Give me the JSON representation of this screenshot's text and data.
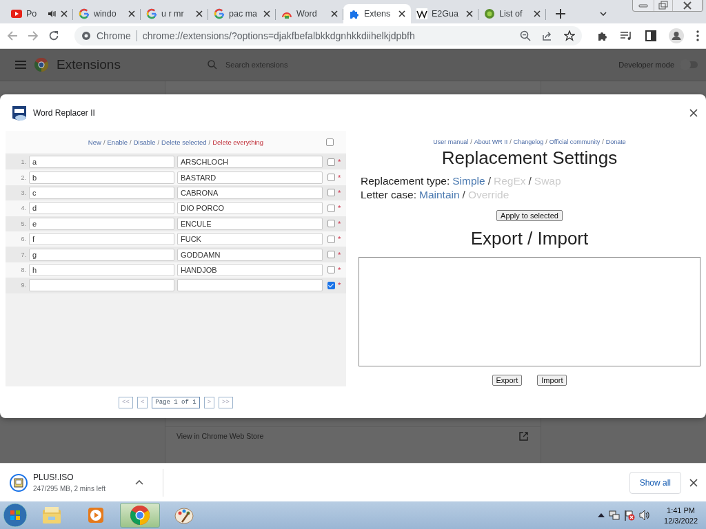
{
  "browser": {
    "tabs": [
      {
        "title": "Po",
        "kind": "youtube",
        "audio": true,
        "selected": false
      },
      {
        "title": "windo",
        "kind": "google",
        "audio": false,
        "selected": false
      },
      {
        "title": "u r mr",
        "kind": "google",
        "audio": false,
        "selected": false
      },
      {
        "title": "pac ma",
        "kind": "google",
        "audio": false,
        "selected": false
      },
      {
        "title": "Word",
        "kind": "rainbow",
        "audio": false,
        "selected": false
      },
      {
        "title": "Extens",
        "kind": "puzzle",
        "audio": false,
        "selected": true
      },
      {
        "title": "E2Gua",
        "kind": "wiki",
        "audio": false,
        "selected": false
      },
      {
        "title": "List of",
        "kind": "leaf",
        "audio": false,
        "selected": false
      }
    ],
    "omnibox": {
      "site": "Chrome",
      "url": "chrome://extensions/?options=djakfbefalbkkdgnhkkdiihelkjdpbfh"
    }
  },
  "extensions_page": {
    "title": "Extensions",
    "search": {
      "placeholder": "Search extensions"
    },
    "developer_mode": {
      "label": "Developer mode",
      "on": false
    },
    "card_link": "View in Chrome Web Store"
  },
  "dialog": {
    "title": "Word Replacer II",
    "separator": "/",
    "toolbar_links": [
      {
        "label": "New",
        "kind": "normal"
      },
      {
        "label": "Enable",
        "kind": "normal"
      },
      {
        "label": "Disable",
        "kind": "normal"
      },
      {
        "label": "Delete selected",
        "kind": "normal"
      },
      {
        "label": "Delete everything",
        "kind": "danger"
      }
    ],
    "select_all": false,
    "rows": [
      {
        "number": "1.",
        "find": "a",
        "replace": "ARSCHLOCH",
        "checked": false,
        "marker": "*"
      },
      {
        "number": "2.",
        "find": "b",
        "replace": "BASTARD",
        "checked": false,
        "marker": "*"
      },
      {
        "number": "3.",
        "find": "c",
        "replace": "CABRONA",
        "checked": false,
        "marker": "*"
      },
      {
        "number": "4.",
        "find": "d",
        "replace": "DIO PORCO",
        "checked": false,
        "marker": "*"
      },
      {
        "number": "5.",
        "find": "e",
        "replace": "ENCULE",
        "checked": false,
        "marker": "*"
      },
      {
        "number": "6.",
        "find": "f",
        "replace": "FUCK",
        "checked": false,
        "marker": "*"
      },
      {
        "number": "7.",
        "find": "g",
        "replace": "GODDAMN",
        "checked": false,
        "marker": "*"
      },
      {
        "number": "8.",
        "find": "h",
        "replace": "HANDJOB",
        "checked": false,
        "marker": "*"
      },
      {
        "number": "9.",
        "checked": true,
        "marker": "*"
      }
    ],
    "pager": [
      {
        "label": "<<",
        "disabled": true
      },
      {
        "label": "<",
        "disabled": true
      },
      {
        "label": "Page 1 of 1",
        "disabled": false
      },
      {
        "label": ">",
        "disabled": true
      },
      {
        "label": ">>",
        "disabled": true
      }
    ],
    "help_links": [
      "User manual",
      "About WR II",
      "Changelog",
      "Official community",
      "Donate"
    ],
    "settings": {
      "heading": "Replacement Settings",
      "options": [
        {
          "label": "Replacement type:",
          "choices": [
            {
              "label": "Simple",
              "selected": true
            },
            {
              "label": "RegEx",
              "selected": false
            },
            {
              "label": "Swap",
              "selected": false
            }
          ]
        },
        {
          "label": "Letter case:",
          "choices": [
            {
              "label": "Maintain",
              "selected": true
            },
            {
              "label": "Override",
              "selected": false
            }
          ]
        }
      ],
      "apply_button": "Apply to selected"
    },
    "export_import": {
      "heading": "Export / Import",
      "buttons": [
        "Export",
        "Import"
      ]
    }
  },
  "downloads": {
    "file": "PLUS!.ISO",
    "status": "247/295 MB, 2 mins left",
    "show_all": "Show all"
  },
  "taskbar": {
    "apps": [
      {
        "kind": "explorer",
        "active": false
      },
      {
        "kind": "media",
        "active": false
      },
      {
        "kind": "chrome",
        "active": true
      },
      {
        "kind": "paint",
        "active": false
      }
    ],
    "time": "1:41 PM",
    "date": "12/3/2022"
  }
}
